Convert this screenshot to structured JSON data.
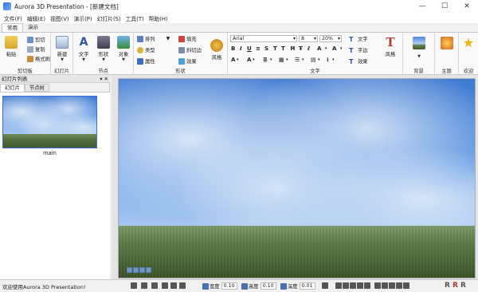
{
  "window": {
    "title": "Aurora 3D Presentation - [新建文档]",
    "controls": {
      "minimize": "—",
      "maximize": "☐",
      "close": "✕"
    }
  },
  "menu": [
    "文件(F)",
    "编辑(E)",
    "视图(V)",
    "演示(P)",
    "幻灯片(S)",
    "工具(T)",
    "帮助(H)"
  ],
  "ribbon_tabs": [
    {
      "label": "常用",
      "active": true
    },
    {
      "label": "演示",
      "active": false
    }
  ],
  "ribbon": {
    "clipboard": {
      "label": "剪切板",
      "paste": "粘贴",
      "cut": "剪切",
      "copy": "复制",
      "format_brush": "格式刷"
    },
    "slides": {
      "label": "幻灯片",
      "new": "新建"
    },
    "nodes": {
      "label": "节点",
      "text": "文字",
      "shape": "形状",
      "object": "对象"
    },
    "shape": {
      "label": "形状",
      "arrange": "排列",
      "type": "类型",
      "property": "属性",
      "fill": "填充",
      "bevel": "斜切边",
      "effect": "效果",
      "style": "风格"
    },
    "text": {
      "label": "文字",
      "font": "Arial",
      "size": "8",
      "zoom": "20%",
      "text_btn": "文字",
      "stroke": "字边",
      "effect": "效果",
      "style": "风格"
    },
    "background": {
      "label": "背景"
    },
    "theme": {
      "label": "主题"
    },
    "welcome": {
      "label": "欢迎"
    }
  },
  "panel": {
    "title": "幻灯片列表",
    "controls": "▾ ✕",
    "tabs": [
      "幻灯片",
      "节点树"
    ],
    "slides": [
      {
        "label": "main"
      }
    ]
  },
  "status": {
    "message": "欢迎使用Aurora 3D Presentation!",
    "width_label": "宽度",
    "width_value": "0.10",
    "height_label": "高度",
    "height_value": "0.10",
    "depth_label": "深度",
    "depth_value": "0.01"
  }
}
